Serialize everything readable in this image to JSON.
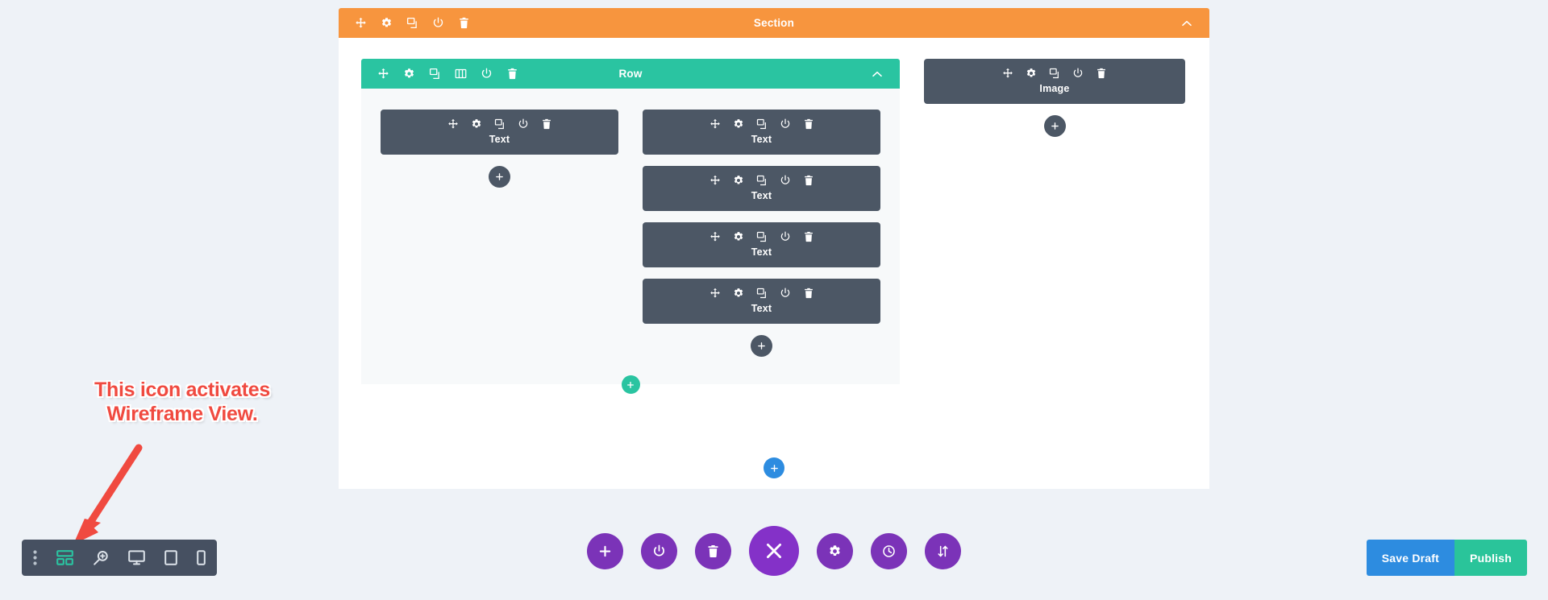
{
  "colors": {
    "page_bg": "#eef2f7",
    "section_bar": "#f7953e",
    "row_bar": "#2ac4a1",
    "module_bg": "#4c5765",
    "purple": "#7b33b8",
    "purple_main": "#8431c8",
    "blue": "#2d8ce0",
    "teal": "#2ac49a",
    "annotation_red": "#f04a40",
    "wireframe_active": "#2ac4a1"
  },
  "section": {
    "title": "Section",
    "collapse_icon": "chevron-up-icon",
    "toolbar": [
      {
        "name": "move-icon",
        "label": "Move Section"
      },
      {
        "name": "gear-icon",
        "label": "Section Settings"
      },
      {
        "name": "duplicate-icon",
        "label": "Duplicate Section"
      },
      {
        "name": "power-icon",
        "label": "Disable Section"
      },
      {
        "name": "trash-icon",
        "label": "Delete Section"
      }
    ]
  },
  "row": {
    "title": "Row",
    "collapse_icon": "chevron-up-icon",
    "toolbar": [
      {
        "name": "move-icon",
        "label": "Move Row"
      },
      {
        "name": "gear-icon",
        "label": "Row Settings"
      },
      {
        "name": "duplicate-icon",
        "label": "Duplicate Row"
      },
      {
        "name": "columns-icon",
        "label": "Column Structure"
      },
      {
        "name": "power-icon",
        "label": "Disable Row"
      },
      {
        "name": "trash-icon",
        "label": "Delete Row"
      }
    ]
  },
  "module_toolbar": [
    {
      "name": "move-icon",
      "label": "Move Module"
    },
    {
      "name": "gear-icon",
      "label": "Module Settings"
    },
    {
      "name": "duplicate-icon",
      "label": "Duplicate Module"
    },
    {
      "name": "power-icon",
      "label": "Disable Module"
    },
    {
      "name": "trash-icon",
      "label": "Delete Module"
    }
  ],
  "columns": [
    {
      "modules": [
        {
          "label": "Text"
        }
      ],
      "add_label": "+"
    },
    {
      "modules": [
        {
          "label": "Text"
        },
        {
          "label": "Text"
        },
        {
          "label": "Text"
        },
        {
          "label": "Text"
        }
      ],
      "add_label": "+"
    }
  ],
  "side_column": {
    "modules": [
      {
        "label": "Image"
      }
    ],
    "add_label": "+"
  },
  "add_buttons": {
    "add_row_label": "+",
    "add_section_label": "+"
  },
  "center_toolbar": [
    {
      "name": "add-icon",
      "label": "Add New Section",
      "size": "small"
    },
    {
      "name": "power-icon",
      "label": "Disable Builder",
      "size": "small"
    },
    {
      "name": "trash-icon",
      "label": "Delete Layout",
      "size": "small"
    },
    {
      "name": "close-icon",
      "label": "Close Builder Menu",
      "size": "large"
    },
    {
      "name": "gear-icon",
      "label": "Page Settings",
      "size": "small"
    },
    {
      "name": "history-icon",
      "label": "Editing History",
      "size": "small"
    },
    {
      "name": "portability-icon",
      "label": "Portability",
      "size": "small"
    }
  ],
  "left_toolbar": [
    {
      "name": "more-options-icon",
      "label": "More Options",
      "active": false
    },
    {
      "name": "wireframe-icon",
      "label": "Wireframe View",
      "active": true
    },
    {
      "name": "zoom-out-icon",
      "label": "Zoom Out View",
      "active": false
    },
    {
      "name": "desktop-icon",
      "label": "Desktop View",
      "active": false
    },
    {
      "name": "tablet-icon",
      "label": "Tablet View",
      "active": false
    },
    {
      "name": "phone-icon",
      "label": "Phone View",
      "active": false
    }
  ],
  "actions": {
    "save_draft": "Save Draft",
    "publish": "Publish"
  },
  "annotation": {
    "line1": "This icon activates",
    "line2": "Wireframe View.",
    "arrow": "arrow-pointing-down-left"
  }
}
